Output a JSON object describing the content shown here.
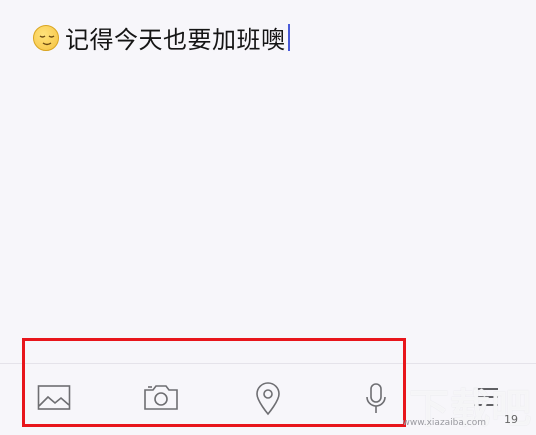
{
  "editor": {
    "text": "记得今天也要加班噢",
    "emoji_icon": "relieved-face-emoji"
  },
  "toolbar": {
    "items": [
      {
        "icon": "image-icon"
      },
      {
        "icon": "camera-icon"
      },
      {
        "icon": "location-pin-icon"
      },
      {
        "icon": "microphone-icon"
      },
      {
        "icon": "menu-icon"
      }
    ]
  },
  "char_count": "19",
  "watermark": {
    "brand": "下载吧",
    "url": "www.xiazaiba.com"
  },
  "colors": {
    "background": "#f7f6fa",
    "caret": "#4a5bd8",
    "highlight": "#e8151b",
    "icon": "#6e6e72"
  }
}
